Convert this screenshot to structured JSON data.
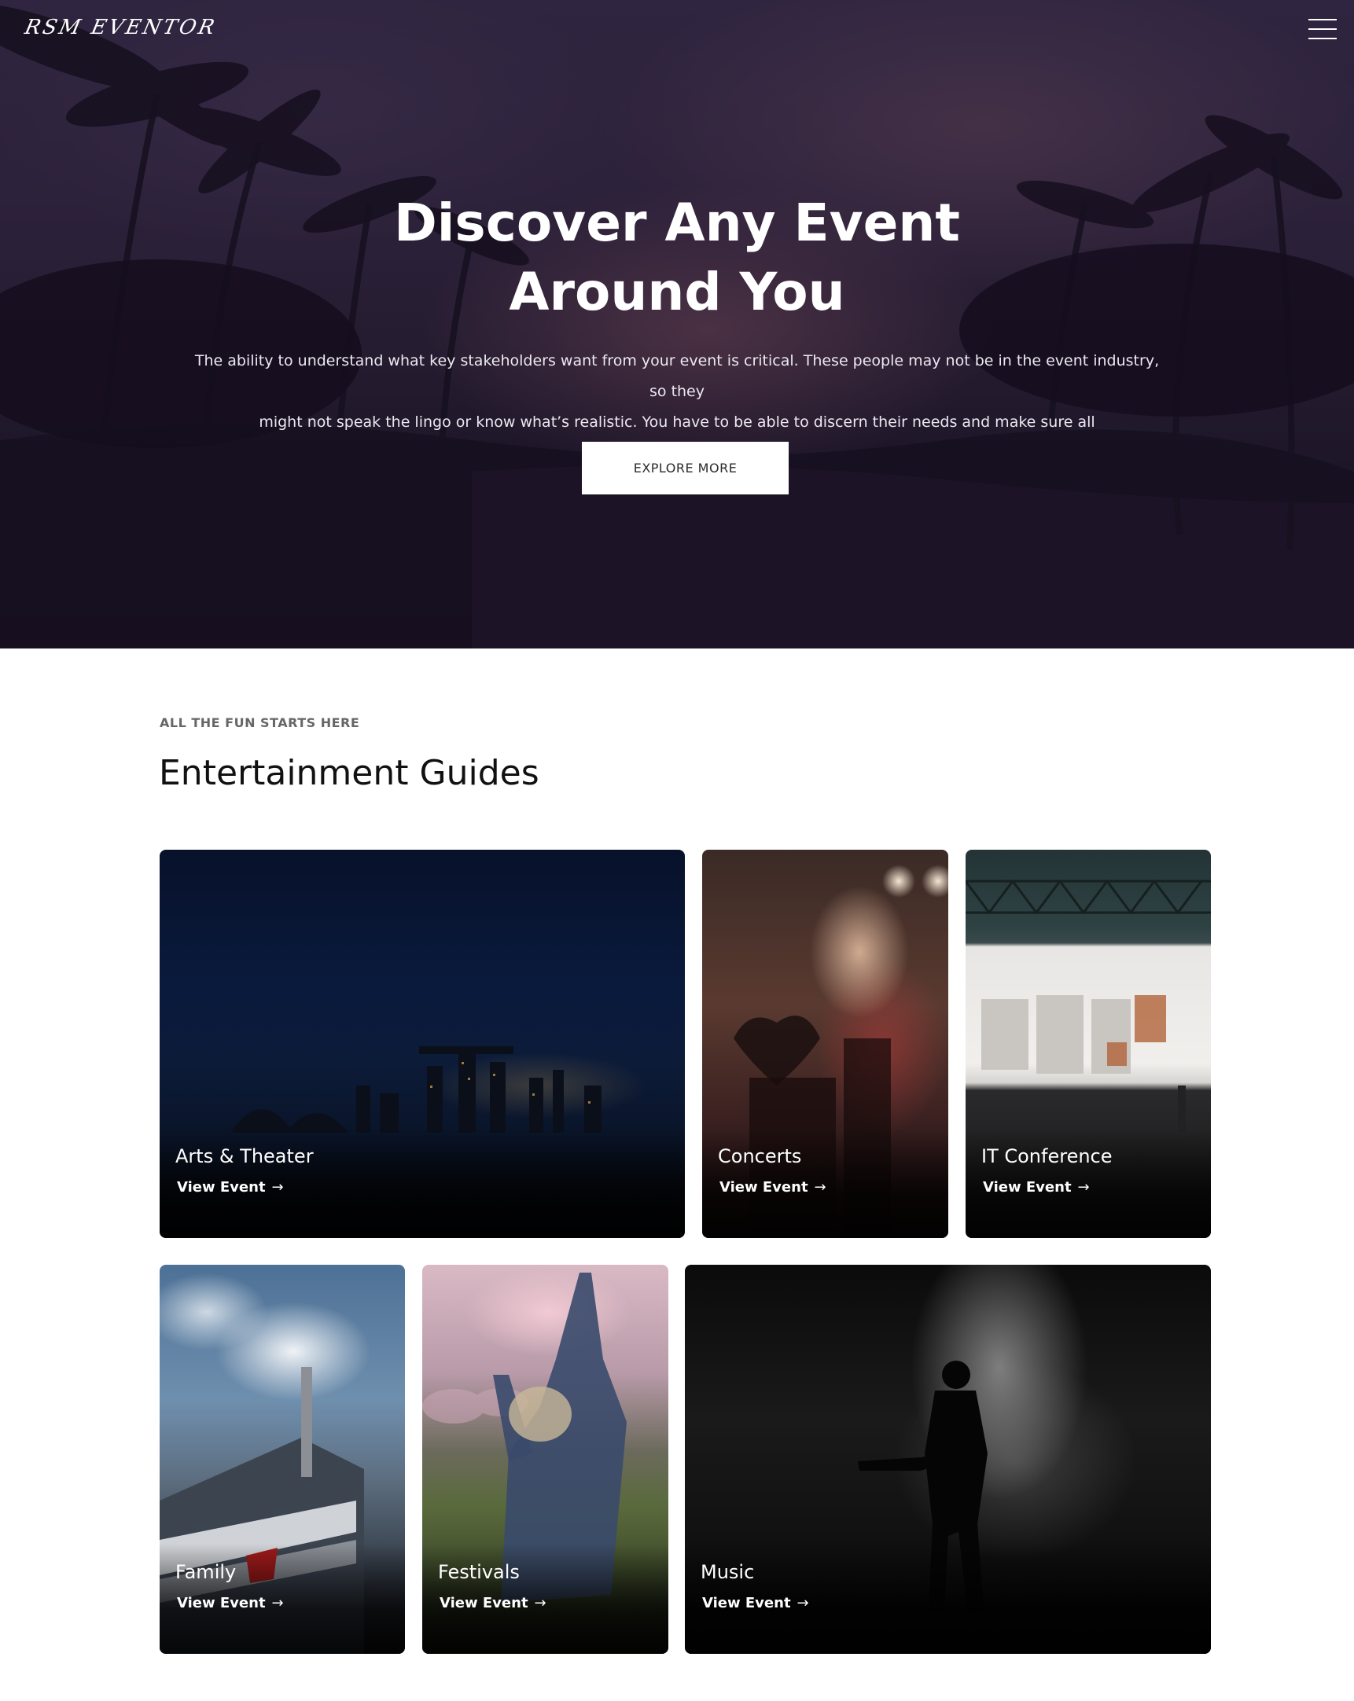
{
  "header": {
    "logo": "RSM EVENTOR",
    "menu_icon": "hamburger-menu-icon"
  },
  "hero": {
    "title_line1": "Discover Any Event",
    "title_line2": "Around You",
    "description_line1": "The ability to understand what key stakeholders want from your event is critical. These people may not be in the event industry, so they",
    "description_line2": "might not speak the lingo or know what’s realistic. You have to be able to discern their needs and make sure all",
    "button_label": "EXPLORE MORE"
  },
  "section": {
    "eyebrow": "ALL THE FUN STARTS HERE",
    "title": "Entertainment Guides"
  },
  "cards": [
    {
      "name": "Arts & Theater",
      "link": "View Event",
      "arrow_icon": "arrow-right-icon"
    },
    {
      "name": "Concerts",
      "link": "View Event",
      "arrow_icon": "arrow-right-icon"
    },
    {
      "name": "IT Conference",
      "link": "View Event",
      "arrow_icon": "arrow-right-icon"
    },
    {
      "name": "Family",
      "link": "View Event",
      "arrow_icon": "arrow-right-icon"
    },
    {
      "name": "Festivals",
      "link": "View Event",
      "arrow_icon": "arrow-right-icon"
    },
    {
      "name": "Music",
      "link": "View Event",
      "arrow_icon": "arrow-right-icon"
    }
  ],
  "colors": {
    "hero_tint": "#2f2538",
    "button_bg": "#ffffff",
    "heading": "#111111",
    "eyebrow": "#666666"
  }
}
